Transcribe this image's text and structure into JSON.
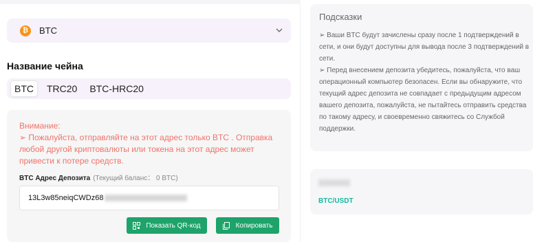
{
  "coin_select": {
    "icon": "bitcoin-icon",
    "value": "BTC"
  },
  "chain": {
    "title": "Название чейна",
    "tabs": [
      "BTC",
      "TRC20",
      "BTC-HRC20"
    ]
  },
  "deposit": {
    "warning_title": "Внимание:",
    "warning_text": "➢ Пожалуйста, отправляйте на этот адрес только BTC . Отправка любой другой криптовалюты или токена на этот адрес может привести к потере средств.",
    "address_label": "BTC Адрес Депозита",
    "balance_text": "(Текущий баланс： 0 BTC)",
    "address_visible": "13L3w85neiqCWDz68",
    "qr_button": "Показать QR-код",
    "copy_button": "Копировать"
  },
  "hints": {
    "title": "Подсказки",
    "text_1": "➢ Ваши BTC будут зачислены сразу после 1 подтверждений в сети, и они будут доступны для вывода после 3 подтверждений в сети.",
    "text_2": "➢ Перед внесением депозита убедитесь, пожалуйста, что ваш операционный компьютер безопасен. Если вы обнаружите, что текущий адрес депозита не совпадает с предыдущим адресом вашего депозита, пожалуйста, не пытайтесь отправить средства по такому адресу, и своевременно свяжитесь со Службой поддержки."
  },
  "pair": {
    "label": "BTC/USDT"
  },
  "colors": {
    "accent_green": "#1ea36a",
    "warning_red": "#f0736a",
    "teal": "#14b8a0",
    "bitcoin_orange": "#f7931a"
  }
}
